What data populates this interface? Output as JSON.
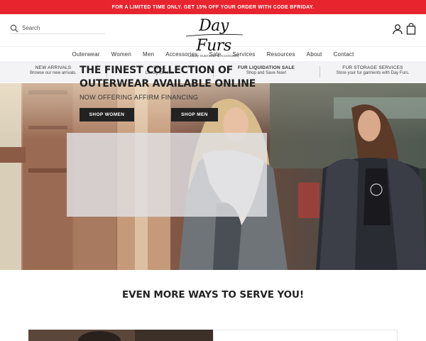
{
  "promo_bar": {
    "text": "FOR A LIMITED TIME ONLY. GET 15% OFF YOUR ORDER WITH CODE BFRIDAY."
  },
  "header": {
    "search_placeholder": "Search",
    "logo_text": "Day Furs",
    "logo_tagline": "Luxury Outerwear & Accessories",
    "icons": [
      "search-icon",
      "account-icon",
      "cart-icon"
    ]
  },
  "nav": {
    "items": [
      {
        "label": "Outerwear"
      },
      {
        "label": "Women"
      },
      {
        "label": "Men"
      },
      {
        "label": "Accessories"
      },
      {
        "label": "Sale"
      },
      {
        "label": "Services"
      },
      {
        "label": "Resources"
      },
      {
        "label": "About"
      },
      {
        "label": "Contact"
      }
    ]
  },
  "services": {
    "items": [
      {
        "title": "NEW ARRIVALS",
        "subtitle": "Browse our new arrivals."
      },
      {
        "title": "SALE",
        "subtitle": "Luxury for less."
      },
      {
        "title": "FUR LIQUIDATION SALE",
        "subtitle": "Shop and Save Now!"
      },
      {
        "title": "FUR STORAGE SERVICES",
        "subtitle": "Store your fur garments with Day Furs."
      }
    ]
  },
  "hero": {
    "headline": "THE FINEST COLLECTION OF OUTERWEAR AVAILABLE ONLINE",
    "subline": "NOW OFFERING AFFIRM FINANCING",
    "button_women": "SHOP WOMEN",
    "button_men": "SHOP MEN"
  },
  "section": {
    "heading": "EVEN MORE WAYS TO SERVE YOU!"
  },
  "colors": {
    "promo_red": "#e8242f",
    "button_dark": "#222222",
    "strip_bg": "#f3f3f5"
  }
}
